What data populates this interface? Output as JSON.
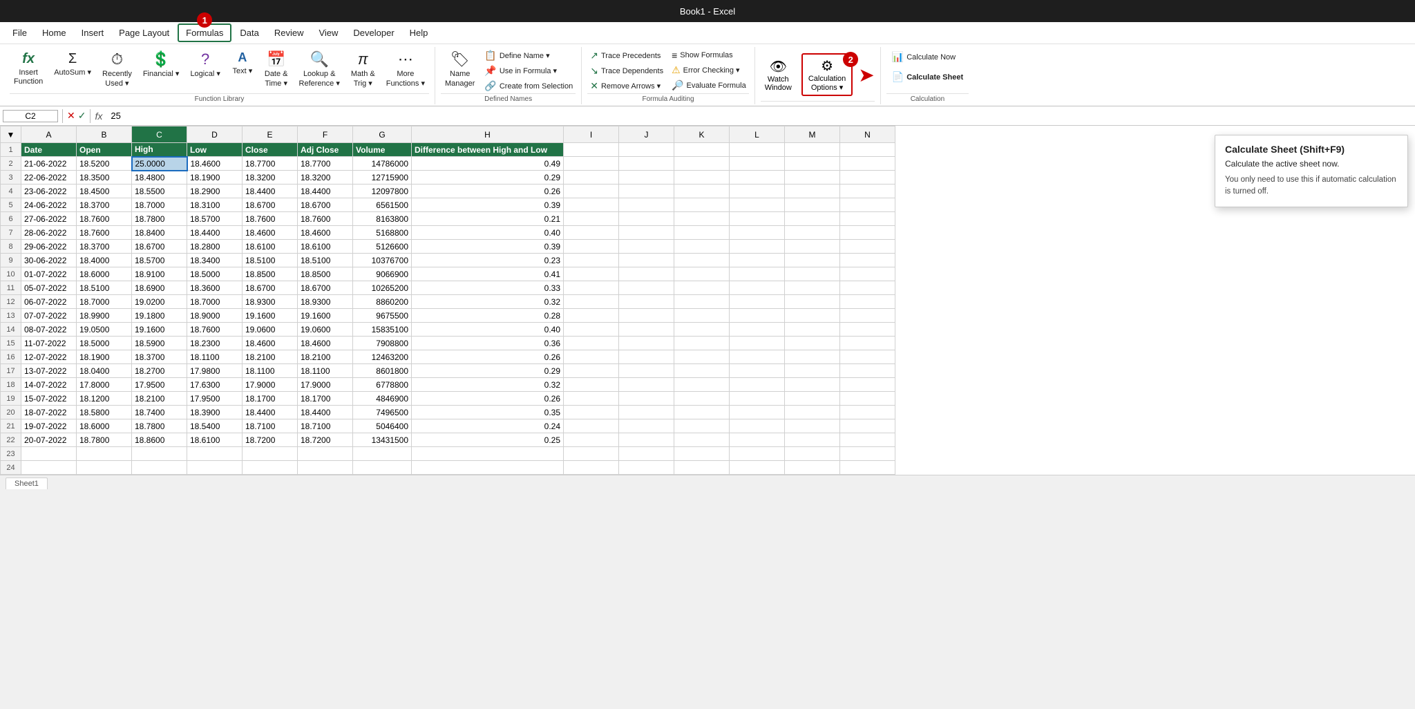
{
  "titleBar": {
    "text": "Book1 - Excel"
  },
  "menuBar": {
    "items": [
      "File",
      "Home",
      "Insert",
      "Page Layout",
      "Formulas",
      "Data",
      "Review",
      "View",
      "Developer",
      "Help"
    ],
    "activeIndex": 4,
    "step1Badge": "1"
  },
  "ribbon": {
    "groups": [
      {
        "label": "Function Library",
        "items": [
          {
            "icon": "fx",
            "label": "Insert\nFunction",
            "name": "insert-function-btn"
          },
          {
            "icon": "Σ",
            "label": "AutoSum",
            "name": "autosum-btn"
          },
          {
            "icon": "⏱",
            "label": "Recently\nUsed",
            "name": "recently-used-btn"
          },
          {
            "icon": "🏦",
            "label": "Financial",
            "name": "financial-btn"
          },
          {
            "icon": "?",
            "label": "Logical",
            "name": "logical-btn"
          },
          {
            "icon": "A",
            "label": "Text",
            "name": "text-btn"
          },
          {
            "icon": "📅",
            "label": "Date &\nTime",
            "name": "date-time-btn"
          },
          {
            "icon": "🔍",
            "label": "Lookup &\nReference",
            "name": "lookup-reference-btn"
          },
          {
            "icon": "π",
            "label": "Math &\nTrig",
            "name": "math-trig-btn"
          },
          {
            "icon": "⋯",
            "label": "More\nFunctions",
            "name": "more-functions-btn"
          }
        ]
      },
      {
        "label": "Defined Names",
        "items": [
          {
            "icon": "🏷",
            "label": "Name\nManager",
            "name": "name-manager-btn"
          },
          {
            "icon": "📋",
            "label": "Define Name",
            "name": "define-name-btn"
          },
          {
            "icon": "📌",
            "label": "Use in Formula",
            "name": "use-in-formula-btn"
          },
          {
            "icon": "🔗",
            "label": "Create from Selection",
            "name": "create-from-selection-btn"
          }
        ]
      },
      {
        "label": "Formula Auditing",
        "smallItems": [
          {
            "icon": "↗",
            "label": "Trace Precedents",
            "name": "trace-precedents-btn"
          },
          {
            "icon": "↘",
            "label": "Trace Dependents",
            "name": "trace-dependents-btn"
          },
          {
            "icon": "✕",
            "label": "Remove Arrows",
            "name": "remove-arrows-btn"
          },
          {
            "icon": "⚠",
            "label": "Error Checking",
            "name": "error-checking-btn"
          },
          {
            "icon": "≡",
            "label": "Show Formulas",
            "name": "show-formulas-btn"
          },
          {
            "icon": "🔍",
            "label": "Evaluate Formula",
            "name": "evaluate-formula-btn"
          }
        ]
      },
      {
        "label": "",
        "watchLabel": "Watch\nWindow",
        "calcOptionsLabel": "Calculation\nOptions",
        "step2Badge": "2"
      },
      {
        "label": "Calculation",
        "calcNowLabel": "Calculate Now",
        "calcSheetLabel": "Calculate Sheet"
      }
    ]
  },
  "formulaBar": {
    "nameBox": "C2",
    "value": "25"
  },
  "columns": [
    "A",
    "B",
    "C",
    "D",
    "E",
    "F",
    "G",
    "H",
    "I",
    "J",
    "K",
    "L",
    "M",
    "N"
  ],
  "selectedCol": "C",
  "headers": [
    "Date",
    "Open",
    "High",
    "Low",
    "Close",
    "Adj Close",
    "Volume",
    "Difference between High and Low"
  ],
  "rows": [
    [
      "21-06-2022",
      "18.5200",
      "25.0000",
      "18.4600",
      "18.7700",
      "18.7700",
      "14786000",
      "0.49"
    ],
    [
      "22-06-2022",
      "18.3500",
      "18.4800",
      "18.1900",
      "18.3200",
      "18.3200",
      "12715900",
      "0.29"
    ],
    [
      "23-06-2022",
      "18.4500",
      "18.5500",
      "18.2900",
      "18.4400",
      "18.4400",
      "12097800",
      "0.26"
    ],
    [
      "24-06-2022",
      "18.3700",
      "18.7000",
      "18.3100",
      "18.6700",
      "18.6700",
      "6561500",
      "0.39"
    ],
    [
      "27-06-2022",
      "18.7600",
      "18.7800",
      "18.5700",
      "18.7600",
      "18.7600",
      "8163800",
      "0.21"
    ],
    [
      "28-06-2022",
      "18.7600",
      "18.8400",
      "18.4400",
      "18.4600",
      "18.4600",
      "5168800",
      "0.40"
    ],
    [
      "29-06-2022",
      "18.3700",
      "18.6700",
      "18.2800",
      "18.6100",
      "18.6100",
      "5126600",
      "0.39"
    ],
    [
      "30-06-2022",
      "18.4000",
      "18.5700",
      "18.3400",
      "18.5100",
      "18.5100",
      "10376700",
      "0.23"
    ],
    [
      "01-07-2022",
      "18.6000",
      "18.9100",
      "18.5000",
      "18.8500",
      "18.8500",
      "9066900",
      "0.41"
    ],
    [
      "05-07-2022",
      "18.5100",
      "18.6900",
      "18.3600",
      "18.6700",
      "18.6700",
      "10265200",
      "0.33"
    ],
    [
      "06-07-2022",
      "18.7000",
      "19.0200",
      "18.7000",
      "18.9300",
      "18.9300",
      "8860200",
      "0.32"
    ],
    [
      "07-07-2022",
      "18.9900",
      "19.1800",
      "18.9000",
      "19.1600",
      "19.1600",
      "9675500",
      "0.28"
    ],
    [
      "08-07-2022",
      "19.0500",
      "19.1600",
      "18.7600",
      "19.0600",
      "19.0600",
      "15835100",
      "0.40"
    ],
    [
      "11-07-2022",
      "18.5000",
      "18.5900",
      "18.2300",
      "18.4600",
      "18.4600",
      "7908800",
      "0.36"
    ],
    [
      "12-07-2022",
      "18.1900",
      "18.3700",
      "18.1100",
      "18.2100",
      "18.2100",
      "12463200",
      "0.26"
    ],
    [
      "13-07-2022",
      "18.0400",
      "18.2700",
      "17.9800",
      "18.1100",
      "18.1100",
      "8601800",
      "0.29"
    ],
    [
      "14-07-2022",
      "17.8000",
      "17.9500",
      "17.6300",
      "17.9000",
      "17.9000",
      "6778800",
      "0.32"
    ],
    [
      "15-07-2022",
      "18.1200",
      "18.2100",
      "17.9500",
      "18.1700",
      "18.1700",
      "4846900",
      "0.26"
    ],
    [
      "18-07-2022",
      "18.5800",
      "18.7400",
      "18.3900",
      "18.4400",
      "18.4400",
      "7496500",
      "0.35"
    ],
    [
      "19-07-2022",
      "18.6000",
      "18.7800",
      "18.5400",
      "18.7100",
      "18.7100",
      "5046400",
      "0.24"
    ],
    [
      "20-07-2022",
      "18.7800",
      "18.8600",
      "18.6100",
      "18.7200",
      "18.7200",
      "13431500",
      "0.25"
    ]
  ],
  "tooltip": {
    "title": "Calculate Sheet (Shift+F9)",
    "subtitle": "Calculate the active sheet now.",
    "body": "You only need to use this if automatic calculation is turned off."
  },
  "sheetTab": "Sheet1",
  "step1": "1",
  "step2": "2"
}
